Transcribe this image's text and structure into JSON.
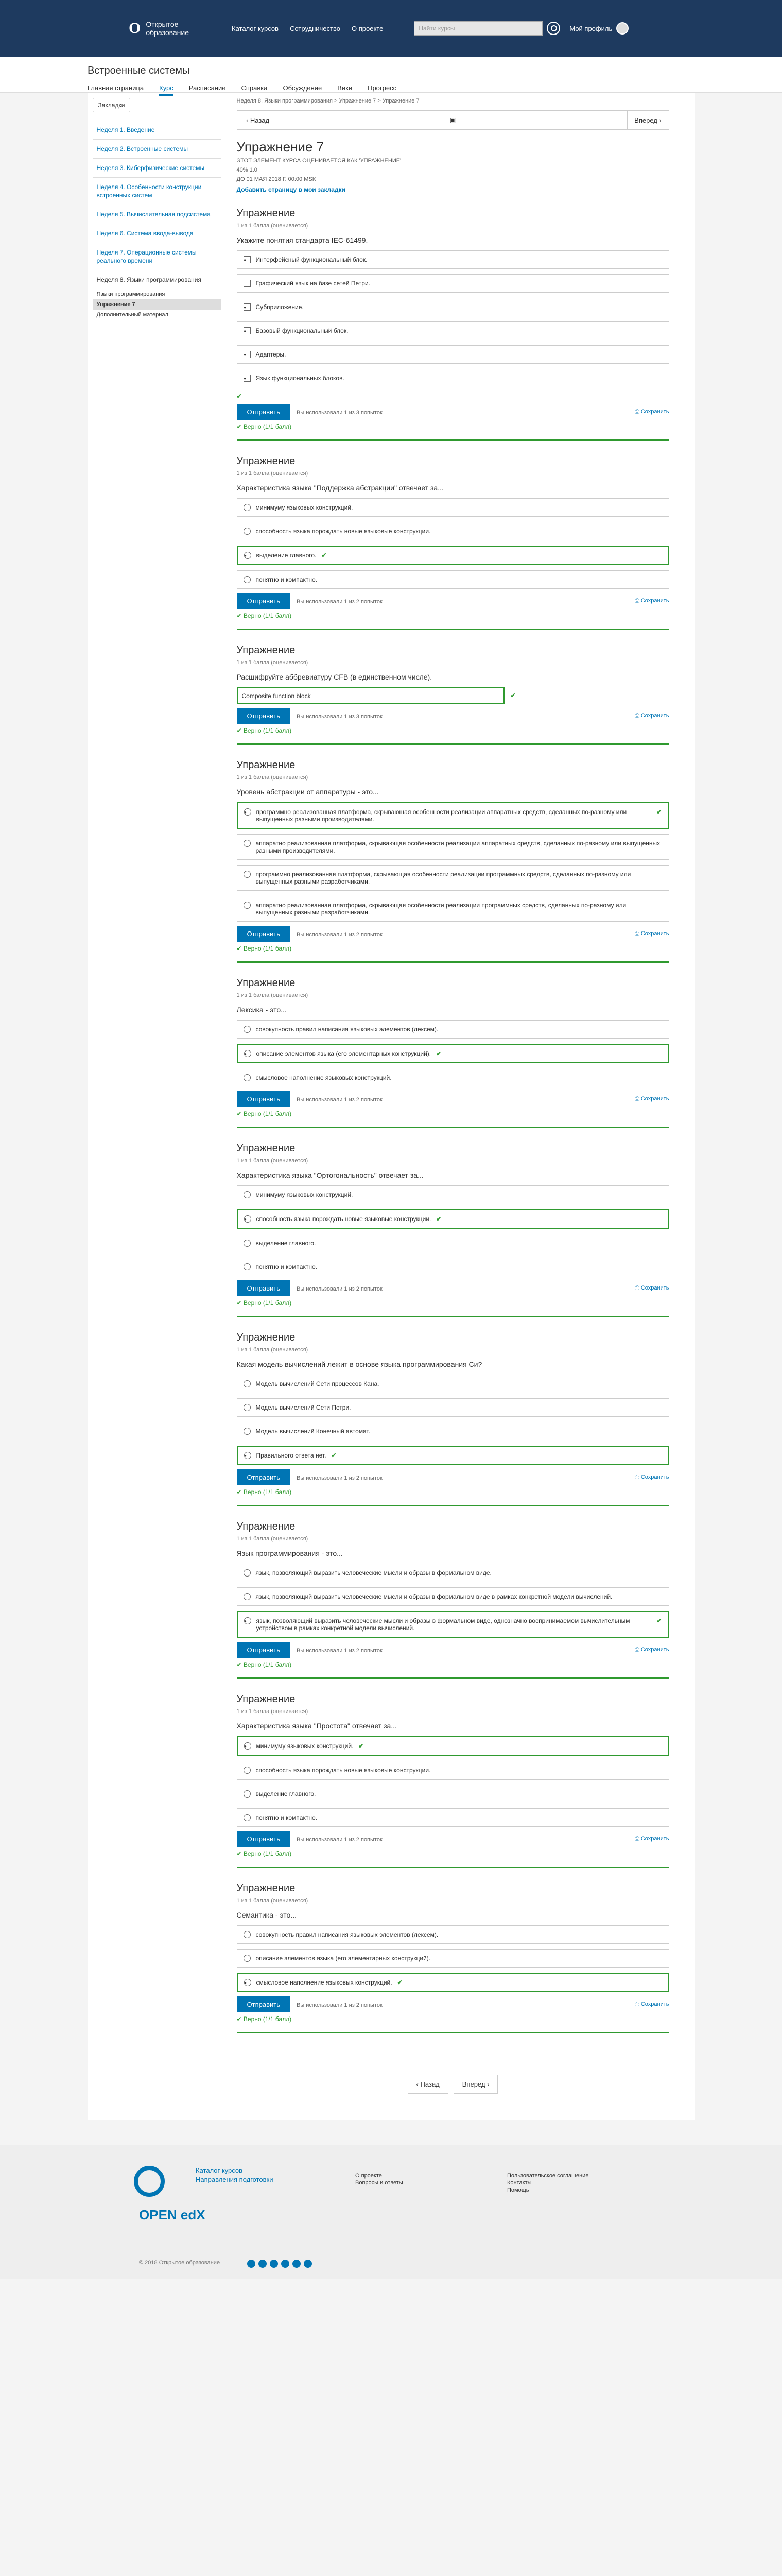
{
  "header": {
    "logo_mark": "O",
    "logo_text": "Открытое образование",
    "nav": [
      "Каталог курсов",
      "Сотрудничество",
      "О проекте"
    ],
    "search_placeholder": "Найти курсы",
    "profile": "Мой профиль"
  },
  "course": {
    "title": "Встроенные системы",
    "tabs": [
      "Главная страница",
      "Курс",
      "Расписание",
      "Справка",
      "Обсуждение",
      "Вики",
      "Прогресс"
    ]
  },
  "sidebar": {
    "bookmarks": "Закладки",
    "items": [
      "Неделя 1. Введение",
      "Неделя 2. Встроенные системы",
      "Неделя 3. Киберфизические системы",
      "Неделя 4. Особенности конструкции встроенных систем",
      "Неделя 5. Вычислительная подсистема",
      "Неделя 6. Система ввода-вывода",
      "Неделя 7. Операционные системы реального времени",
      "Неделя 8. Языки программирования"
    ],
    "subitems": [
      "Языки программирования",
      "Упражнение 7",
      "Дополнительный материал"
    ]
  },
  "breadcrumbs": "Неделя 8. Языки программирования > Упражнение 7 > Упражнение 7",
  "seq": {
    "prev": "Назад",
    "next": "Вперед"
  },
  "unit": {
    "title": "Упражнение 7",
    "meta": [
      "ЭТОТ ЭЛЕМЕНТ КУРСА ОЦЕНИВАЕТСЯ КАК 'УПРАЖНЕНИЕ'",
      "40% 1.0",
      "ДО 01 МАЯ 2018 Г. 00:00 MSK"
    ],
    "bookmark": "Добавить страницу в мои закладки"
  },
  "problems": [
    {
      "title": "Упражнение",
      "points": "1 из 1 балла (оценивается)",
      "question": "Укажите понятия стандарта IEC-61499.",
      "type": "check",
      "choices": [
        "Интерфейсный функциональный блок.",
        "Графический язык на базе сетей Петри.",
        "Субприложение.",
        "Базовый функциональный блок.",
        "Адаптеры.",
        "Язык функциональных блоков."
      ],
      "selected": [
        0,
        2,
        3,
        4,
        5
      ],
      "attempts": "Вы использовали 1 из 3 попыток"
    },
    {
      "title": "Упражнение",
      "points": "1 из 1 балла (оценивается)",
      "question": "Характеристика языка \"Поддержка абстракции\" отвечает за...",
      "type": "radio",
      "choices": [
        "минимуму языковых конструкций.",
        "способность языка порождать новые языковые конструкции.",
        "выделение главного.",
        "понятно и компактно."
      ],
      "selected": [
        2
      ],
      "attempts": "Вы использовали 1 из 2 попыток"
    },
    {
      "title": "Упражнение",
      "points": "1 из 1 балла (оценивается)",
      "question": "Расшифруйте аббревиатуру CFB (в единственном числе).",
      "type": "text",
      "answer": "Composite function block",
      "attempts": "Вы использовали 1 из 3 попыток"
    },
    {
      "title": "Упражнение",
      "points": "1 из 1 балла (оценивается)",
      "question": "Уровень абстракции от аппаратуры - это...",
      "type": "radio",
      "choices": [
        "программно реализованная платформа, скрывающая особенности реализации аппаратных средств, сделанных по-разному или выпущенных разными производителями.",
        "аппаратно реализованная платформа, скрывающая особенности реализации аппаратных средств, сделанных по-разному или выпущенных разными производителями.",
        "программно реализованная платформа, скрывающая особенности реализации программных средств, сделанных по-разному или выпущенных разными разработчиками.",
        "аппаратно реализованная платформа, скрывающая особенности реализации программных средств, сделанных по-разному или выпущенных разными разработчиками."
      ],
      "selected": [
        0
      ],
      "attempts": "Вы использовали 1 из 2 попыток"
    },
    {
      "title": "Упражнение",
      "points": "1 из 1 балла (оценивается)",
      "question": "Лексика - это...",
      "type": "radio",
      "choices": [
        "совокупность правил написания языковых элементов (лексем).",
        "описание элементов языка (его элементарных конструкций).",
        "смысловое наполнение языковых конструкций."
      ],
      "selected": [
        1
      ],
      "attempts": "Вы использовали 1 из 2 попыток"
    },
    {
      "title": "Упражнение",
      "points": "1 из 1 балла (оценивается)",
      "question": "Характеристика языка \"Ортогональность\" отвечает за...",
      "type": "radio",
      "choices": [
        "минимуму языковых конструкций.",
        "способность языка порождать новые языковые конструкции.",
        "выделение главного.",
        "понятно и компактно."
      ],
      "selected": [
        1
      ],
      "attempts": "Вы использовали 1 из 2 попыток"
    },
    {
      "title": "Упражнение",
      "points": "1 из 1 балла (оценивается)",
      "question": "Какая модель вычислений лежит в основе языка программирования Си?",
      "type": "radio",
      "choices": [
        "Модель вычислений Сети процессов Кана.",
        "Модель вычислений Сети Петри.",
        "Модель вычислений Конечный автомат.",
        "Правильного ответа нет."
      ],
      "selected": [
        3
      ],
      "attempts": "Вы использовали 1 из 2 попыток"
    },
    {
      "title": "Упражнение",
      "points": "1 из 1 балла (оценивается)",
      "question": "Язык программирования - это...",
      "type": "radio",
      "choices": [
        "язык, позволяющий выразить человеческие мысли и образы в формальном виде.",
        "язык, позволяющий выразить человеческие мысли и образы в формальном виде в рамках конкретной модели вычислений.",
        "язык, позволяющий выразить человеческие мысли и образы в формальном виде, однозначно воспринимаемом вычислительным устройством в рамках конкретной модели вычислений."
      ],
      "selected": [
        2
      ],
      "attempts": "Вы использовали 1 из 2 попыток"
    },
    {
      "title": "Упражнение",
      "points": "1 из 1 балла (оценивается)",
      "question": "Характеристика языка \"Простота\" отвечает за...",
      "type": "radio",
      "choices": [
        "минимуму языковых конструкций.",
        "способность языка порождать новые языковые конструкции.",
        "выделение главного.",
        "понятно и компактно."
      ],
      "selected": [
        0
      ],
      "attempts": "Вы использовали 1 из 2 попыток"
    },
    {
      "title": "Упражнение",
      "points": "1 из 1 балла (оценивается)",
      "question": "Семантика - это...",
      "type": "radio",
      "choices": [
        "совокупность правил написания языковых элементов (лексем).",
        "описание элементов языка (его элементарных конструкций).",
        "смысловое наполнение языковых конструкций."
      ],
      "selected": [
        2
      ],
      "attempts": "Вы использовали 1 из 2 попыток"
    }
  ],
  "labels": {
    "submit": "Отправить",
    "save": "Сохранить",
    "result": "Верно (1/1 балл)"
  },
  "footer": {
    "links": [
      "Каталог курсов",
      "Направления подготовки"
    ],
    "links2": [
      "О проекте",
      "Вопросы и ответы"
    ],
    "links3": [
      "Пользовательское соглашение",
      "Контакты",
      "Помощь"
    ],
    "copyright": "© 2018 Открытое образование",
    "platform": "OPEN edX"
  }
}
